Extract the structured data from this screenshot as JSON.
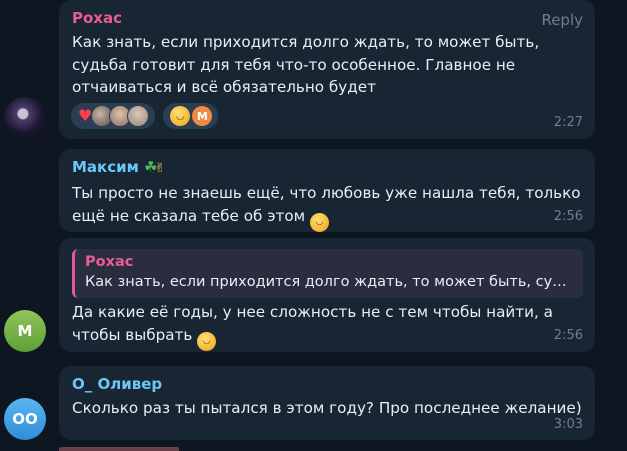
{
  "messages": [
    {
      "author": "Рохас",
      "author_color": "#e85d93",
      "reply_label": "Reply",
      "text": "Как знать, если приходится долго ждать, то может быть, судьба готовит для тебя что-то особенное. Главное не отчаиваться и всё обязательно будет",
      "time": "2:27",
      "reactions": [
        {
          "emoji_icon": "heart-icon",
          "avatars": 3
        },
        {
          "emoji_icon": "grinning-face-icon",
          "avatar_letter": "M"
        }
      ]
    },
    {
      "author": "Максим",
      "author_color": "#6cc7f6",
      "author_badges": [
        "clover-icon",
        "hand-icon"
      ],
      "text": "Ты просто не знаешь ещё, что любовь уже нашла тебя, только ещё не сказала тебе об этом",
      "emoji_icon": "smiling-face-icon",
      "time": "2:56"
    },
    {
      "quote_author": "Рохас",
      "quote_text": "Как знать, если приходится долго ждать, то может быть, судьба готовит для тебя что-то особенное.",
      "text": "Да какие её годы, у нее сложность не с тем чтобы найти, а чтобы выбрать",
      "emoji_icon": "grinning-face-icon",
      "time": "2:56",
      "avatar_letter": "M"
    },
    {
      "author": "О_ Оливер",
      "author_color": "#6cc7f6",
      "text": "Сколько раз ты пытался в этом году? Про последнее желание)",
      "time": "3:03",
      "avatar_letter": "OO"
    }
  ]
}
